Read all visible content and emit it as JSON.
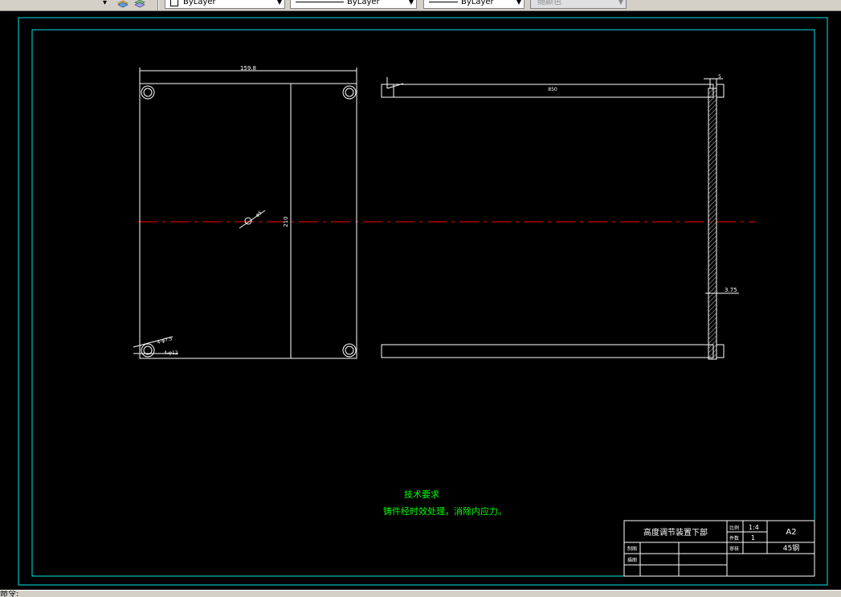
{
  "toolbar": {
    "layer_linetype_label": "ByLayer",
    "linetype_label": "ByLayer",
    "lineweight_label": "ByLayer",
    "plotstyle_label": "随颜色",
    "layer_icon": "layers-icon",
    "layer_states_icon": "layer-states-icon"
  },
  "drawing": {
    "colors": {
      "border": "#00e5e5",
      "geometry": "#ffffff",
      "centerline": "#ff0000",
      "notes": "#00ff00",
      "background": "#000000"
    },
    "front_view": {
      "width_dim": "159.8",
      "height_dim": "210",
      "diameter_callout": "φ5",
      "hole_callout_1": "4-φ7.5",
      "hole_callout_2": "4-φ12"
    },
    "side_view": {
      "length_dim": "850",
      "thickness_dim": "5",
      "offset_dim": "3.75"
    },
    "notes": {
      "title": "技术要求",
      "line1": "铸件经时效处理，消除内应力。"
    },
    "title_block": {
      "part_name": "高度调节装置下部",
      "scale_label": "比例",
      "scale_value": "1:4",
      "qty_label": "件数",
      "qty_value": "1",
      "sheet_size": "A2",
      "drawn_label": "制图",
      "checked_label": "描图",
      "review_label": "审核",
      "material": "45钢"
    }
  },
  "statusbar": {
    "command_prompt": "命令:"
  }
}
